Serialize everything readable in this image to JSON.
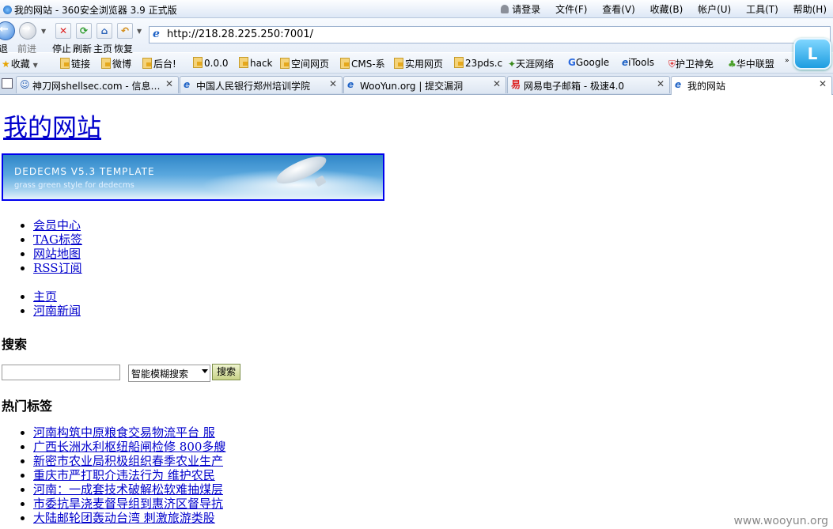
{
  "window": {
    "title": "我的网站 - 360安全浏览器 3.9 正式版"
  },
  "menubar": {
    "login": "请登录",
    "items": [
      "文件(F)",
      "查看(V)",
      "收藏(B)",
      "帐户(U)",
      "工具(T)",
      "帮助(H)"
    ]
  },
  "navbar": {
    "back_label": "后退",
    "forward_label": "前进",
    "stop_label": "停止",
    "refresh_label": "刷新",
    "home_label": "主页",
    "restore_label": "恢复",
    "address": "http://218.28.225.250:7001/"
  },
  "favbar": {
    "favorites_label": "收藏",
    "items": [
      "链接",
      "微博",
      "后台!",
      "0.0.0",
      "hack",
      "空间网页",
      "CMS-系",
      "实用网页",
      "23pds.c",
      "天涯网络",
      "Google",
      "iTools",
      "护卫神免",
      "华中联盟"
    ],
    "L_badge": "L"
  },
  "tabs": [
    {
      "label": "神刀网shellsec.com - 信息…"
    },
    {
      "label": "中国人民银行郑州培训学院"
    },
    {
      "label": "WooYun.org | 提交漏洞"
    },
    {
      "label": "网易电子邮箱 - 极速4.0"
    },
    {
      "label": "我的网站"
    }
  ],
  "page": {
    "site_title": "我的网站",
    "banner_title": "DEDECMS V5.3 TEMPLATE",
    "banner_subtitle": "grass green style for dedecms",
    "member_links": [
      "会员中心",
      "TAG标签",
      "网站地图",
      "RSS订阅"
    ],
    "nav_links": [
      "主页",
      "河南新闻"
    ],
    "search_heading": "搜索",
    "search_mode": "智能模糊搜索",
    "search_button": "搜索",
    "tags_heading": "热门标签",
    "tags": [
      "河南构筑中原粮食交易物流平台 服",
      "广西长洲水利枢纽船闸检修 800多艘",
      "新密市农业局积极组织春季农业生产",
      "重庆市严打职介违法行为 维护农民",
      "河南：一成套技术破解松软难抽煤层",
      "市委抗旱浇麦督导组到惠济区督导抗",
      "大陆邮轮团轰动台湾 刺激旅游类股"
    ]
  },
  "watermark": "www.wooyun.org",
  "colors": {
    "link": "#0000cc",
    "banner_border": "#0000ee",
    "search_button_bg": "#c9d488"
  }
}
